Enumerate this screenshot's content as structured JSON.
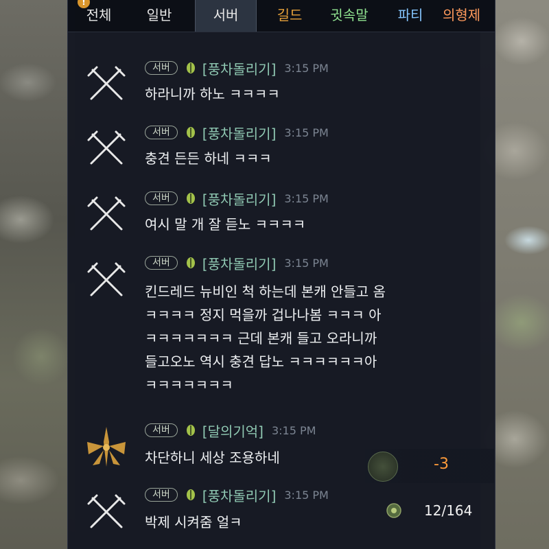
{
  "tabs": [
    {
      "label": "전체",
      "color": "#e8e8e8"
    },
    {
      "label": "일반",
      "color": "#e8e8e8"
    },
    {
      "label": "서버",
      "color": "#e8e8e8",
      "active": true
    },
    {
      "label": "길드",
      "color": "#e7a23a"
    },
    {
      "label": "귓속말",
      "color": "#8fe08f"
    },
    {
      "label": "파티",
      "color": "#86c6ff"
    },
    {
      "label": "의형제",
      "color": "#ff9a5c"
    }
  ],
  "notification_badge": "!",
  "messages": [
    {
      "channel": "서버",
      "name": "[풍차돌리기]",
      "time": "3:15 PM",
      "avatar_icon": "crossed-swords-icon",
      "lines": [
        "하라니까 하노 ㅋㅋㅋㅋ"
      ]
    },
    {
      "channel": "서버",
      "name": "[풍차돌리기]",
      "time": "3:15 PM",
      "avatar_icon": "crossed-swords-icon",
      "lines": [
        "충견 든든 하네 ㅋㅋㅋ"
      ]
    },
    {
      "channel": "서버",
      "name": "[풍차돌리기]",
      "time": "3:15 PM",
      "avatar_icon": "crossed-swords-icon",
      "lines": [
        "여시 말 개 잘 듣노 ㅋㅋㅋㅋ"
      ]
    },
    {
      "channel": "서버",
      "name": "[풍차돌리기]",
      "time": "3:15 PM",
      "avatar_icon": "crossed-swords-icon",
      "lines": [
        "킨드레드 뉴비인 척 하는데 본캐 안들고 옴",
        "ㅋㅋㅋㅋ 정지 먹을까 겁나나봄 ㅋㅋㅋ 아",
        "ㅋㅋㅋㅋㅋㅋㅋ 근데 본캐 들고 오라니까",
        "들고오노 역시 충견 답노 ㅋㅋㅋㅋㅋㅋ아",
        "ㅋㅋㅋㅋㅋㅋㅋ"
      ]
    },
    {
      "channel": "서버",
      "name": "[달의기억]",
      "time": "3:15 PM",
      "avatar_icon": "golden-emblem-icon",
      "lines": [
        "차단하니 세상 조용하네"
      ]
    },
    {
      "channel": "서버",
      "name": "[풍차돌리기]",
      "time": "3:15 PM",
      "avatar_icon": "crossed-swords-icon",
      "lines": [
        "박제 시켜줌 얼ㅋ"
      ]
    }
  ],
  "hud": {
    "item_value": "-3",
    "count": "12/164"
  },
  "colors": {
    "name": "#8fc8b2",
    "time": "#7c8592",
    "text": "#eef0f2",
    "negative": "#ff9b3a"
  }
}
